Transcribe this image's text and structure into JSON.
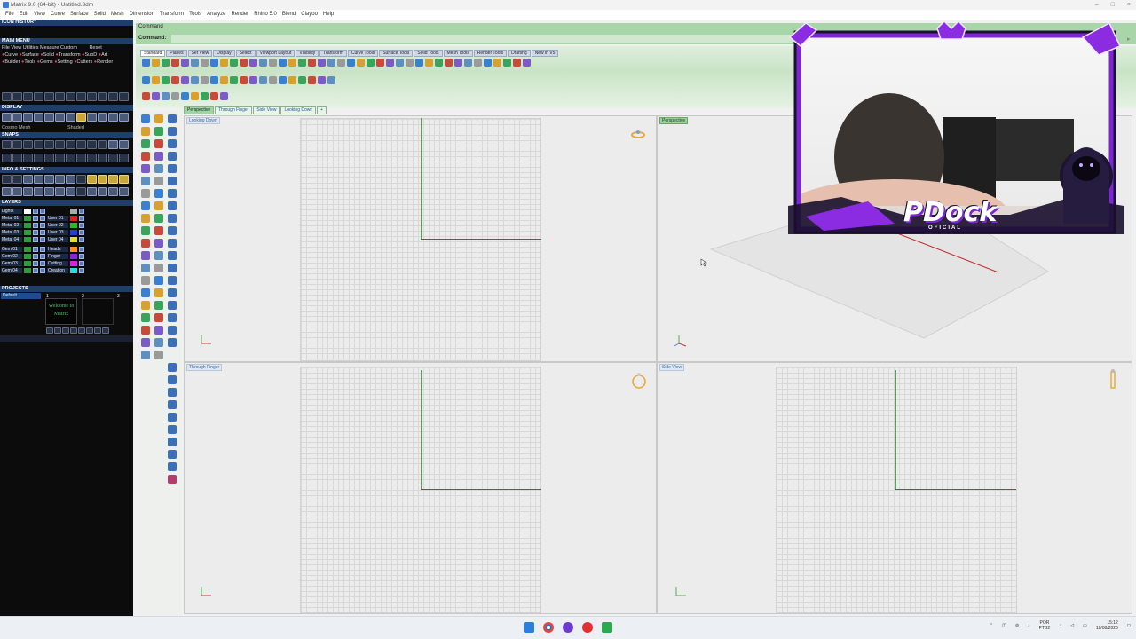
{
  "window": {
    "title": "Matrix 9.0 (64-bit) - Untitled.3dm",
    "controls": [
      "–",
      "□",
      "×"
    ]
  },
  "menu": [
    "File",
    "Edit",
    "View",
    "Curve",
    "Surface",
    "Solid",
    "Mesh",
    "Dimension",
    "Transform",
    "Tools",
    "Analyze",
    "Render",
    "Rhino 5.0",
    "Blend",
    "Clayoo",
    "Help"
  ],
  "leftpanel": {
    "icon_history": "ICON HISTORY",
    "main_menu": "MAIN MENU",
    "main_menu_row1": [
      "File",
      "View",
      "Utilities",
      "Measure",
      "Custom",
      "Reset"
    ],
    "main_menu_row2": [
      "Curve",
      "Surface",
      "Solid",
      "Transform",
      "SubD",
      "Art"
    ],
    "main_menu_row3": [
      "Builder",
      "Tools",
      "Gems",
      "Setting",
      "Cutters",
      "Render"
    ],
    "display": "DISPLAY",
    "display_fields": [
      "Cosmo Mesh",
      "Shaded"
    ],
    "snaps": "SNAPS",
    "info_settings": "INFO & SETTINGS",
    "layers": "LAYERS",
    "layers_left": [
      "Lights",
      "Metal 01",
      "Metal 02",
      "Metal 03",
      "Metal 04",
      "Gem 01",
      "Gem 02",
      "Gem 03",
      "Gem 04"
    ],
    "layers_right": [
      "",
      "User 01",
      "User 02",
      "User 03",
      "User 04",
      "Heads",
      "Finger",
      "Cutting",
      "Creation"
    ],
    "projects": "PROJECTS",
    "project_default": "Default",
    "project_thumb_text": "Welcome to Matrix",
    "project_nums": [
      "1",
      "2",
      "3"
    ]
  },
  "command": {
    "line1": "Command",
    "line2": "Command:"
  },
  "toolbar_tabs": [
    "Standard",
    "Planes",
    "Set View",
    "Display",
    "Select",
    "Viewport Layout",
    "Visibility",
    "Transform",
    "Curve Tools",
    "Surface Tools",
    "Solid Tools",
    "Mesh Tools",
    "Render Tools",
    "Drafting",
    "New in V5"
  ],
  "viewport_tabs": [
    "Perspective",
    "Through Finger",
    "Side View",
    "Looking Down",
    "+"
  ],
  "viewports": {
    "top_left": "Looking Down",
    "top_right": "Perspective",
    "bottom_left": "Through Finger",
    "bottom_right": "Side View"
  },
  "overlay": {
    "brand": "PDock",
    "sub": "OFICIAL"
  },
  "taskbar": {
    "lang1": "POR",
    "lang2": "PTB2",
    "time": "15:12",
    "date": "18/08/2026"
  },
  "colors": {
    "accent": "#1f3f6a",
    "command_bg": "#a9d6a9",
    "overlay_purple": "#8b2be2"
  }
}
